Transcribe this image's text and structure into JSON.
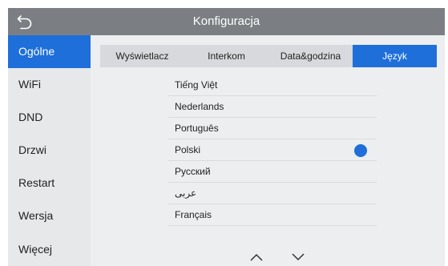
{
  "header": {
    "title": "Konfiguracja",
    "back_icon": "back-arrow-icon"
  },
  "sidebar": {
    "items": [
      {
        "label": "Ogólne",
        "active": true
      },
      {
        "label": "WiFi"
      },
      {
        "label": "DND"
      },
      {
        "label": "Drzwi"
      },
      {
        "label": "Restart"
      },
      {
        "label": "Wersja"
      },
      {
        "label": "Więcej"
      }
    ]
  },
  "tabs": [
    {
      "label": "Wyświetlacz"
    },
    {
      "label": "Interkom"
    },
    {
      "label": "Data&godzina"
    },
    {
      "label": "Język",
      "active": true
    }
  ],
  "languages": [
    {
      "label": "Tiếng Việt"
    },
    {
      "label": "Nederlands"
    },
    {
      "label": "Português"
    },
    {
      "label": "Polski",
      "selected": true
    },
    {
      "label": "Русский"
    },
    {
      "label": "عربى"
    },
    {
      "label": "Français"
    }
  ],
  "pager": {
    "up_icon": "chevron-up-icon",
    "down_icon": "chevron-down-icon"
  },
  "colors": {
    "accent": "#1e6fd9",
    "topbar": "#7b7f83",
    "background": "#eceef0"
  }
}
